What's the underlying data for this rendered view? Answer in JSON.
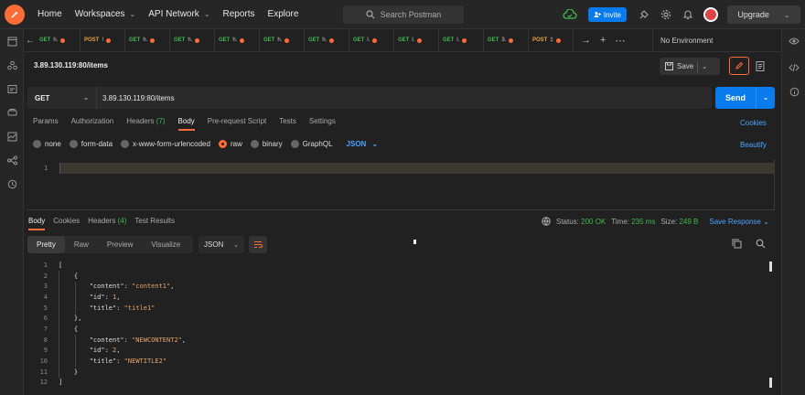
{
  "topbar": {
    "nav": [
      {
        "label": "Home",
        "chevron": false
      },
      {
        "label": "Workspaces",
        "chevron": true
      },
      {
        "label": "API Network",
        "chevron": true
      },
      {
        "label": "Reports",
        "chevron": false
      },
      {
        "label": "Explore",
        "chevron": false
      }
    ],
    "search_placeholder": "Search Postman",
    "invite_label": "Invite",
    "upgrade_label": "Upgrade"
  },
  "tabs": [
    {
      "method": "GET",
      "name": "h.",
      "method_color": "#3fb950"
    },
    {
      "method": "POST",
      "name": "!",
      "method_color": "#e8a33a"
    },
    {
      "method": "GET",
      "name": "h.",
      "method_color": "#3fb950"
    },
    {
      "method": "GET",
      "name": "h.",
      "method_color": "#3fb950"
    },
    {
      "method": "GET",
      "name": "h.",
      "method_color": "#3fb950"
    },
    {
      "method": "GET",
      "name": "h.",
      "method_color": "#3fb950"
    },
    {
      "method": "GET",
      "name": "h.",
      "method_color": "#3fb950"
    },
    {
      "method": "GET",
      "name": "l.",
      "method_color": "#3fb950"
    },
    {
      "method": "GET",
      "name": "l.",
      "method_color": "#3fb950"
    },
    {
      "method": "GET",
      "name": "l.",
      "method_color": "#3fb950"
    },
    {
      "method": "GET",
      "name": "3.",
      "method_color": "#3fb950"
    },
    {
      "method": "POST",
      "name": "‡",
      "method_color": "#e8a33a"
    }
  ],
  "environment": "No Environment",
  "request": {
    "title": "3.89.130.119:80/items",
    "save_label": "Save",
    "method": "GET",
    "url": "3.89.130.119:80/items",
    "send_label": "Send",
    "tabs": [
      "Params",
      "Authorization",
      "Headers",
      "Body",
      "Pre-request Script",
      "Tests",
      "Settings"
    ],
    "headers_count": "(7)",
    "cookies_label": "Cookies",
    "body_types": [
      "none",
      "form-data",
      "x-www-form-urlencoded",
      "raw",
      "binary",
      "GraphQL"
    ],
    "body_format": "JSON",
    "beautify_label": "Beautify",
    "editor_line": "1"
  },
  "response": {
    "tabs": [
      "Body",
      "Cookies",
      "Headers",
      "Test Results"
    ],
    "headers_count": "(4)",
    "status_label": "Status:",
    "status_value": "200 OK",
    "time_label": "Time:",
    "time_value": "235 ms",
    "size_label": "Size:",
    "size_value": "249 B",
    "save_response_label": "Save Response",
    "view_modes": [
      "Pretty",
      "Raw",
      "Preview",
      "Visualize"
    ],
    "format": "JSON"
  },
  "code_lines": [
    {
      "num": "1",
      "indent": "",
      "parts": [
        [
          "p",
          "["
        ]
      ]
    },
    {
      "num": "2",
      "indent": "    ",
      "parts": [
        [
          "p",
          "{"
        ]
      ]
    },
    {
      "num": "3",
      "indent": "        ",
      "parts": [
        [
          "k",
          "\"content\""
        ],
        [
          "p",
          ": "
        ],
        [
          "s",
          "\"content1\""
        ],
        [
          "p",
          ","
        ]
      ]
    },
    {
      "num": "4",
      "indent": "        ",
      "parts": [
        [
          "k",
          "\"id\""
        ],
        [
          "p",
          ": "
        ],
        [
          "n",
          "1"
        ],
        [
          "p",
          ","
        ]
      ]
    },
    {
      "num": "5",
      "indent": "        ",
      "parts": [
        [
          "k",
          "\"title\""
        ],
        [
          "p",
          ": "
        ],
        [
          "s",
          "\"title1\""
        ]
      ]
    },
    {
      "num": "6",
      "indent": "    ",
      "parts": [
        [
          "p",
          "},"
        ]
      ]
    },
    {
      "num": "7",
      "indent": "    ",
      "parts": [
        [
          "p",
          "{"
        ]
      ]
    },
    {
      "num": "8",
      "indent": "        ",
      "parts": [
        [
          "k",
          "\"content\""
        ],
        [
          "p",
          ": "
        ],
        [
          "s",
          "\"NEWCONTENT2\""
        ],
        [
          "p",
          ","
        ]
      ]
    },
    {
      "num": "9",
      "indent": "        ",
      "parts": [
        [
          "k",
          "\"id\""
        ],
        [
          "p",
          ": "
        ],
        [
          "n",
          "2"
        ],
        [
          "p",
          ","
        ]
      ]
    },
    {
      "num": "10",
      "indent": "        ",
      "parts": [
        [
          "k",
          "\"title\""
        ],
        [
          "p",
          ": "
        ],
        [
          "s",
          "\"NEWTITLE2\""
        ]
      ]
    },
    {
      "num": "11",
      "indent": "    ",
      "parts": [
        [
          "p",
          "}"
        ]
      ]
    },
    {
      "num": "12",
      "indent": "",
      "parts": [
        [
          "p",
          "]"
        ]
      ]
    }
  ]
}
